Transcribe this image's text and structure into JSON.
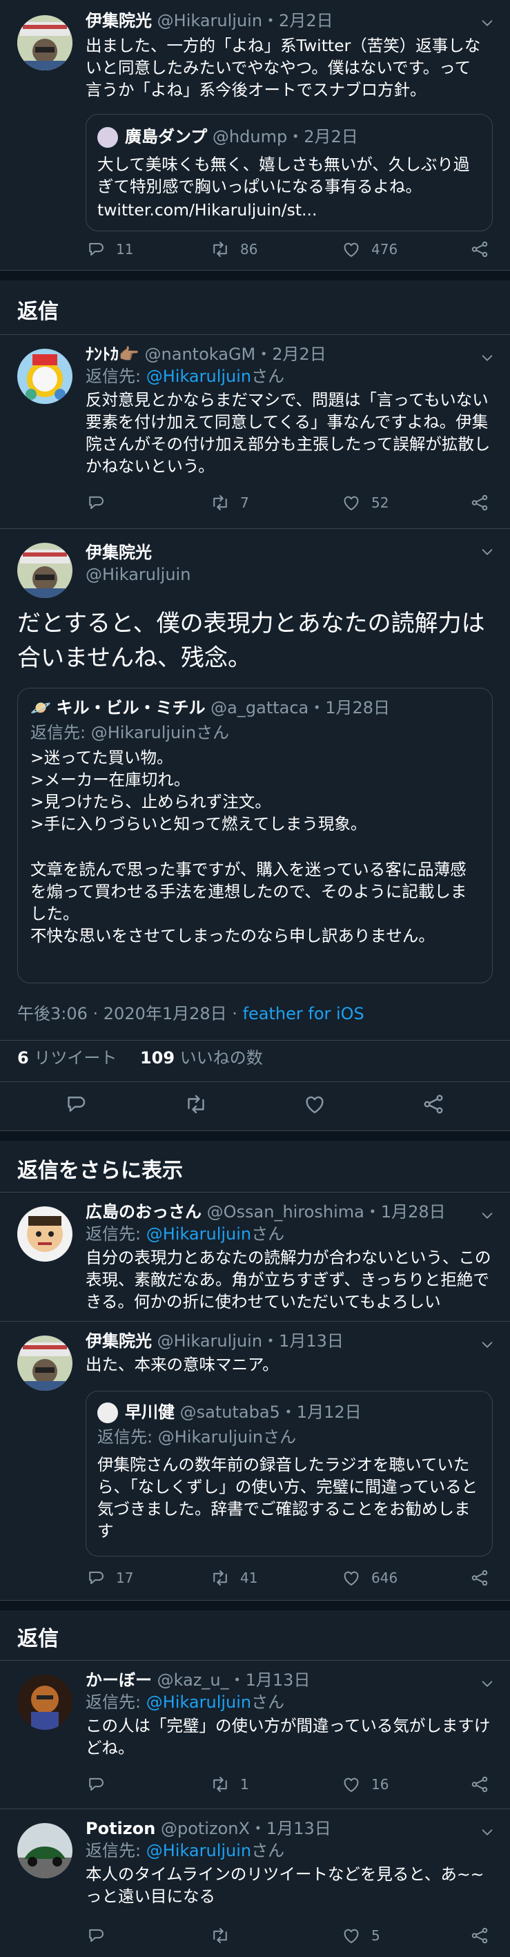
{
  "t1": {
    "name": "伊集院光",
    "handle": "@Hikaruljuin",
    "date": "・2月2日",
    "text": "出ました、一方的「よね」系Twitter（苦笑）返事しないと同意したみたいでやなやつ。僕はないです。って言うか「よね」系今後オートでスナブロ方針。",
    "quote": {
      "name": "廣島ダンプ",
      "handle": "@hdump",
      "date": "・2月2日",
      "text": "大して美味くも無く、嬉しさも無いが、久しぶり過ぎて特別感で胸いっぱいになる事有るよね。",
      "url": "twitter.com/Hikaruljuin/st..."
    },
    "replies": "11",
    "retweets": "86",
    "likes": "476"
  },
  "section_reply": "返信",
  "t2": {
    "name": "ﾅﾝﾄｶ👉🏽",
    "handle": "@nantokaGM",
    "date": "・2月2日",
    "reply_prefix": "返信先:",
    "reply_to": "@Hikaruljuin",
    "reply_suffix": "さん",
    "text": "反対意見とかならまだマシで、問題は「言ってもいない要素を付け加えて同意してくる」事なんですよね。伊集院さんがその付け加え部分も主張したって誤解が拡散しかねないという。",
    "replies": "",
    "retweets": "7",
    "likes": "52"
  },
  "main": {
    "name": "伊集院光",
    "handle": "@Hikaruljuin",
    "text": "だとすると、僕の表現力とあなたの読解力は合いませんね、残念。",
    "quote": {
      "emoji": "🪐",
      "name": "キル・ビル・ミチル",
      "handle": "@a_gattaca",
      "date": "・1月28日",
      "reply_prefix": "返信先:",
      "reply_to": "@Hikaruljuin",
      "reply_suffix": "さん",
      "lines": [
        ">迷ってた買い物。",
        ">メーカー在庫切れ。",
        ">見つけたら、止められず注文。",
        ">手に入りづらいと知って燃えてしまう現象。"
      ],
      "text2": "文章を読んで思った事ですが、購入を迷っている客に品薄感を煽って買わせる手法を連想したので、そのように記載しました。\n不快な思いをさせてしまったのなら申し訳ありません。"
    },
    "time": "午後3:06 · 2020年1月28日 · ",
    "client": "feather for iOS",
    "rt_count": "6",
    "rt_label": "リツイート",
    "like_count": "109",
    "like_label": "いいねの数"
  },
  "section_more": "返信をさらに表示",
  "t3": {
    "name": "広島のおっさん",
    "handle": "@Ossan_hiroshima",
    "date": "・1月28日",
    "reply_prefix": "返信先:",
    "reply_to": "@Hikaruljuin",
    "reply_suffix": "さん",
    "text": "自分の表現力とあなたの読解力が合わないという、この表現、素敵だなあ。角が立ちすぎず、きっちりと拒絶できる。何かの折に使わせていただいてもよろしい"
  },
  "t4": {
    "name": "伊集院光",
    "handle": "@Hikaruljuin",
    "date": "・1月13日",
    "text": "出た、本来の意味マニア。",
    "quote": {
      "name": "早川健",
      "handle": "@satutaba5",
      "date": "・1月12日",
      "reply_prefix": "返信先:",
      "reply_to": "@Hikaruljuin",
      "reply_suffix": "さん",
      "text": "伊集院さんの数年前の録音したラジオを聴いていたら、「なしくずし」の使い方、完璧に間違っていると気づきました。辞書でご確認することをお勧めします"
    },
    "replies": "17",
    "retweets": "41",
    "likes": "646"
  },
  "section_reply2": "返信",
  "t5": {
    "name": "かーぼー",
    "handle": "@kaz_u_",
    "date": "・1月13日",
    "reply_prefix": "返信先:",
    "reply_to": "@Hikaruljuin",
    "reply_suffix": "さん",
    "text": "この人は「完璧」の使い方が間違っている気がしますけどね。",
    "replies": "",
    "retweets": "1",
    "likes": "16"
  },
  "t6": {
    "name": "Potizon",
    "handle": "@potizonX",
    "date": "・1月13日",
    "reply_prefix": "返信先:",
    "reply_to": "@Hikaruljuin",
    "reply_suffix": "さん",
    "text": "本人のタイムラインのリツイートなどを見ると、あ~~っと遠い目になる",
    "replies": "",
    "retweets": "",
    "likes": "5"
  },
  "colors": {
    "bg": "#15202b",
    "muted": "#8899a6",
    "link": "#1da1f2",
    "border": "#38444d"
  }
}
